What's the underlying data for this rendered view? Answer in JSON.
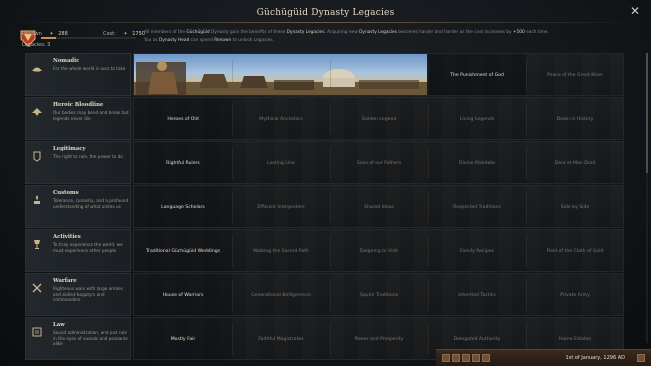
{
  "window": {
    "title": "Güchügüid Dynasty Legacies"
  },
  "header": {
    "renown_label": "Renown",
    "renown_value": "288",
    "cost_label": "Cost:",
    "cost_value": "1750",
    "legacies_label": "Legacies: 3",
    "renown_progress": 0.16,
    "description_line1_a": "All members of the ",
    "description_line1_dyn": "Güchügüid",
    "description_line1_b": " Dynasty gain the benefits of these ",
    "description_line1_c": "Dynasty Legacies",
    "description_line1_d": ". Acquiring new ",
    "description_line1_e": "Dynasty Legacies",
    "description_line1_f": " becomes harder and harder as the cost increases by ",
    "description_line1_g": "500",
    "description_line1_h": " each time.",
    "description_line2_a": "You as ",
    "description_line2_b": "Dynasty Head",
    "description_line2_c": " can spend ",
    "description_line2_d": "Renown",
    "description_line2_e": " to unlock Legacies."
  },
  "legacies": [
    {
      "name": "Nomadic",
      "description": "For the whole world is ours to take",
      "icon": "nomadic-icon",
      "perks": [
        "",
        "",
        "",
        "The Punishment of God",
        "Peace of the Great Khan"
      ],
      "unlocked_count": 3
    },
    {
      "name": "Heroic Bloodline",
      "description": "Our bodies may bend and break but legends never die",
      "icon": "heroic-bloodline-icon",
      "perks": [
        "Heroes of Old",
        "Mythical Ancestors",
        "Golden Legend",
        "Living Legends",
        "Down in History"
      ],
      "unlocked_count": 0
    },
    {
      "name": "Legitimacy",
      "description": "The right to rule, the power to do",
      "icon": "legitimacy-icon",
      "perks": [
        "Rightful Rulers",
        "Lasting Line",
        "Sons of our Fathers",
        "Divine Mandate",
        "Dara et Mon Droit"
      ],
      "unlocked_count": 0
    },
    {
      "name": "Customs",
      "description": "Tolerance, curiosity, and a profound understanding of what unites us",
      "icon": "customs-icon",
      "perks": [
        "Language Scholars",
        "Efficient Interpreters",
        "Shared Ideas",
        "Respected Traditions",
        "Side by Side"
      ],
      "unlocked_count": 0
    },
    {
      "name": "Activities",
      "description": "To truly experience the world, we must experience other people",
      "icon": "activities-icon",
      "perks": [
        "Traditional Güchügüid Weddings",
        "Walking the Sacred Path",
        "Deigning to Visit",
        "Family Recipes",
        "Field of the Cloth of Gold"
      ],
      "unlocked_count": 0
    },
    {
      "name": "Warfare",
      "description": "Righteous wars with large armies and skilled bogatyrs and commanders",
      "icon": "warfare-icon",
      "perks": [
        "House of Warriors",
        "Generational Belligerence",
        "Squire Traditions",
        "Inherited Tactics",
        "Private Army"
      ],
      "unlocked_count": 0
    },
    {
      "name": "Law",
      "description": "Sound administration, and just rule in the eyes of vassals and peasants alike",
      "icon": "law-icon",
      "perks": [
        "Mostly Fair",
        "Faithful Magistrates",
        "Power and Prosperity",
        "Delegated Authority",
        "Home Estates"
      ],
      "unlocked_count": 0
    }
  ],
  "bottom_bar": {
    "date": "1st of January, 1296 AD"
  },
  "colors": {
    "accent_gold": "#c39446",
    "text_light": "#e6dcc6",
    "text_dim": "#7f786c"
  }
}
